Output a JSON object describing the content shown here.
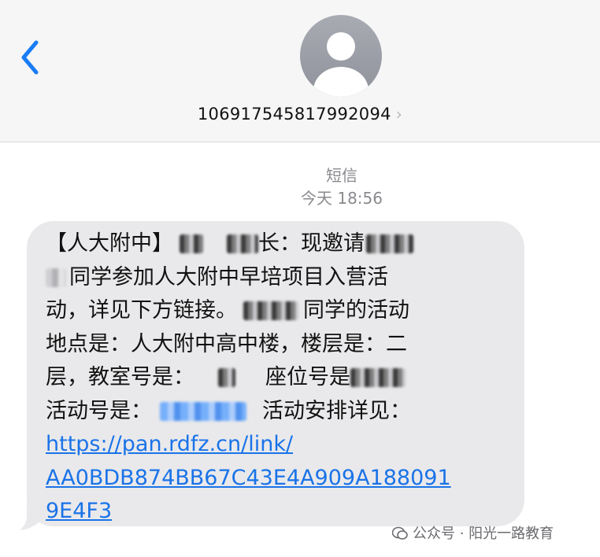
{
  "header": {
    "contact_number": "106917545817992094",
    "chevron": "›"
  },
  "thread": {
    "service_label": "短信",
    "timestamp": "今天 18:56"
  },
  "message": {
    "line1_a": "【人大附中】",
    "line1_b": "长：现邀请",
    "line2_a": "同学参加人大附中早培项目入营活",
    "line3_a": "动，详见下方链接。",
    "line3_b": "同学的活动",
    "line4_a": "地点是：人大附中高中楼，楼层是：二",
    "line5_a": "层，教室号是：",
    "line5_b": "座位号是",
    "line6_a": "活动号是：",
    "line6_b": "活动安排详见：",
    "link_line1": "https://pan.rdfz.cn/link/",
    "link_line2": "AA0BDB874BB67C43E4A909A188091",
    "link_line3": "9E4F3"
  },
  "watermark": {
    "text": "公众号 · 阳光一路教育",
    "icon": "wechat-icon"
  },
  "colors": {
    "accent": "#1a73e8",
    "bubble": "#e9e9eb",
    "header_bg": "#f6f6f6"
  }
}
